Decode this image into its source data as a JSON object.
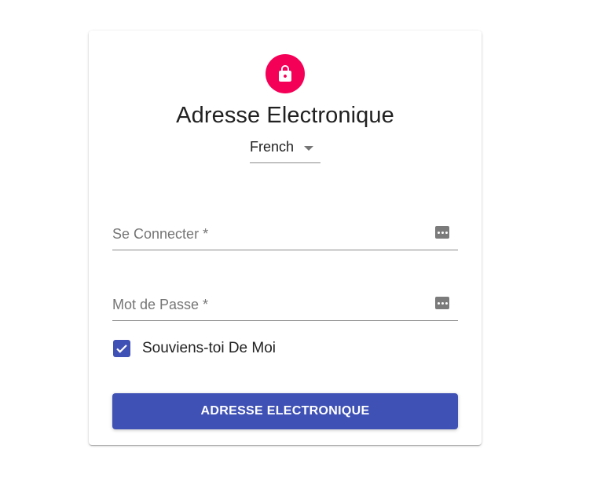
{
  "colors": {
    "accent": "#f50057",
    "primary": "#3f51b5"
  },
  "header": {
    "icon": "lock-icon",
    "title": "Adresse Electronique"
  },
  "language": {
    "selected": "French"
  },
  "form": {
    "username_label": "Se Connecter *",
    "password_label": "Mot de Passe *",
    "field_icon": "password-manager-icon",
    "remember_label": "Souviens-toi De Moi",
    "remember_checked": true,
    "submit_label": "ADRESSE ELECTRONIQUE"
  }
}
